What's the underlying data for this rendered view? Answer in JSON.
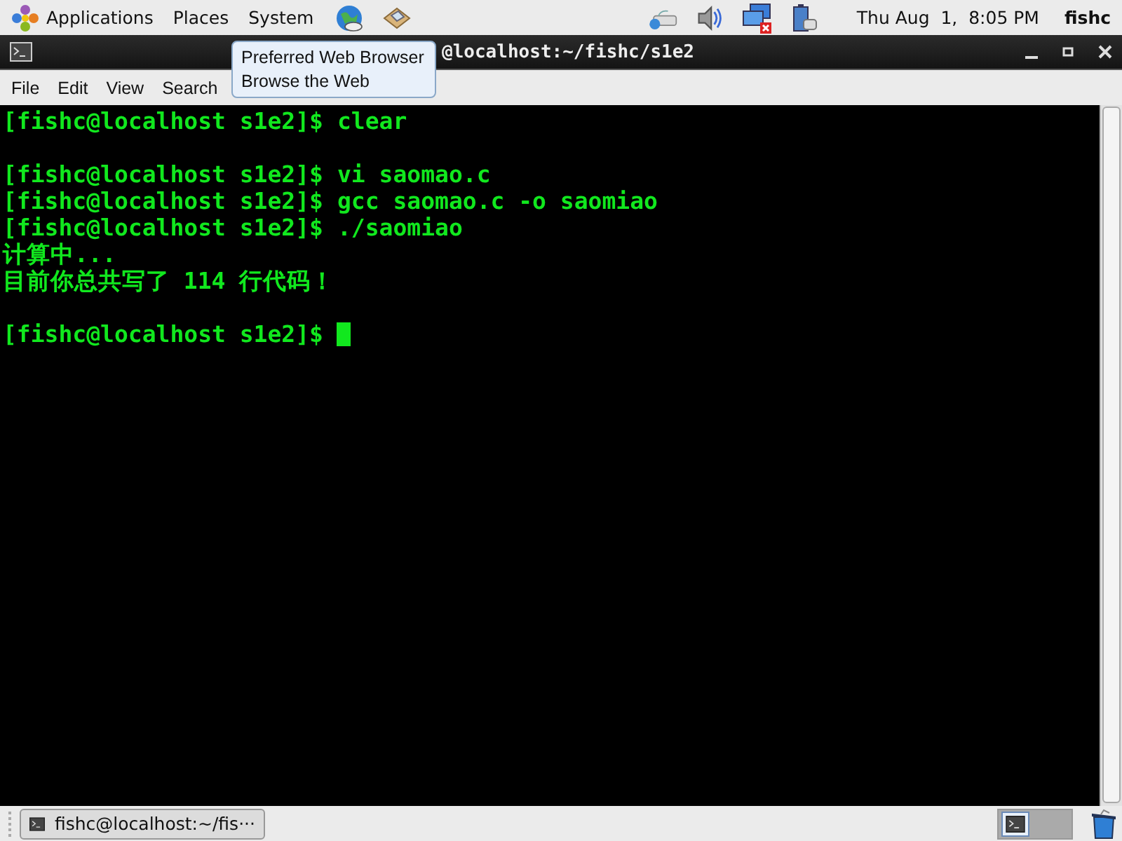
{
  "top_panel": {
    "menus": [
      "Applications",
      "Places",
      "System"
    ],
    "clock": "Thu Aug  1,  8:05 PM",
    "user": "fishc"
  },
  "window": {
    "title": "@localhost:~/fishc/s1e2"
  },
  "tooltip": {
    "lines": [
      "Preferred Web Browser",
      "Browse the Web"
    ]
  },
  "menubar": [
    "File",
    "Edit",
    "View",
    "Search"
  ],
  "terminal": {
    "lines": [
      {
        "kind": "prompt",
        "prompt": "[fishc@localhost s1e2]$",
        "command": "clear"
      },
      {
        "kind": "blank"
      },
      {
        "kind": "prompt",
        "prompt": "[fishc@localhost s1e2]$",
        "command": "vi saomao.c"
      },
      {
        "kind": "prompt",
        "prompt": "[fishc@localhost s1e2]$",
        "command": "gcc saomao.c -o saomiao"
      },
      {
        "kind": "prompt",
        "prompt": "[fishc@localhost s1e2]$",
        "command": "./saomiao"
      },
      {
        "kind": "output",
        "text": "计算中..."
      },
      {
        "kind": "output",
        "text": "目前你总共写了 114 行代码！"
      },
      {
        "kind": "blank"
      },
      {
        "kind": "active_prompt",
        "prompt": "[fishc@localhost s1e2]$"
      }
    ]
  },
  "taskbar": {
    "tasks": [
      {
        "label": "fishc@localhost:~/fis···",
        "selected": false
      }
    ]
  }
}
